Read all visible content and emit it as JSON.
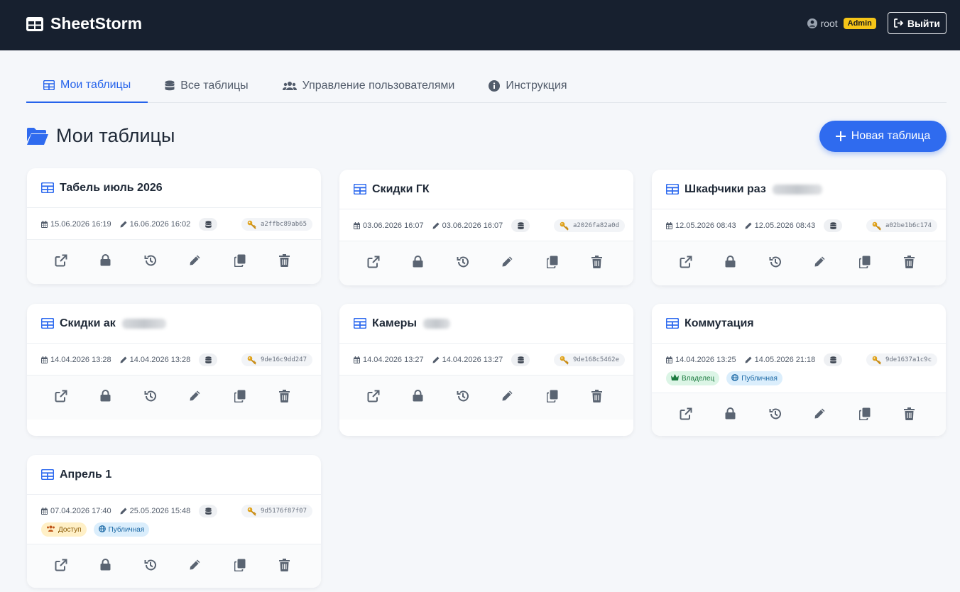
{
  "app": {
    "name": "SheetStorm",
    "user": "root",
    "role_badge": "Admin",
    "logout_label": "Выйти"
  },
  "tabs": [
    {
      "label": "Мои таблицы",
      "icon": "table-icon",
      "active": true
    },
    {
      "label": "Все таблицы",
      "icon": "database-icon",
      "active": false
    },
    {
      "label": "Управление пользователями",
      "icon": "users-icon",
      "active": false
    },
    {
      "label": "Инструкция",
      "icon": "info-icon",
      "active": false
    }
  ],
  "page": {
    "title": "Мои таблицы",
    "new_button": "Новая таблица"
  },
  "cards": [
    {
      "title": "Табель июль 2026",
      "created": "15.06.2026 16:19",
      "modified": "16.06.2026 16:02",
      "key": "a2ffbc89ab65",
      "blurred": false
    },
    {
      "title": "Скидки ГК",
      "created": "03.06.2026 16:07",
      "modified": "03.06.2026 16:07",
      "key": "a2026fa82a0d",
      "blurred": false
    },
    {
      "title": "Шкафчики раз",
      "created": "12.05.2026 08:43",
      "modified": "12.05.2026 08:43",
      "key": "a02be1b6c174",
      "blurred": true
    },
    {
      "title": "Скидки ак",
      "created": "14.04.2026 13:28",
      "modified": "14.04.2026 13:28",
      "key": "9de16c9dd247",
      "blurred": true
    },
    {
      "title": "Камеры",
      "created": "14.04.2026 13:27",
      "modified": "14.04.2026 13:27",
      "key": "9de168c5462e",
      "blurred": true
    },
    {
      "title": "Коммутация",
      "created": "14.04.2026 13:25",
      "modified": "14.05.2026 21:18",
      "key": "9de1637a1c9c",
      "blurred": false,
      "badges": [
        "Владелец",
        "Публичная"
      ]
    },
    {
      "title": "Апрель 1",
      "created": "07.04.2026 17:40",
      "modified": "25.05.2026 15:48",
      "key": "9d5176f87f07",
      "blurred": false,
      "badges": [
        "Доступ",
        "Публичная"
      ]
    }
  ],
  "actions": [
    "open-icon",
    "lock-icon",
    "history-icon",
    "edit-icon",
    "copy-icon",
    "trash-icon"
  ],
  "colors": {
    "navbar": "#17202f",
    "accent": "#2563eb",
    "admin_badge": "#f5c518"
  }
}
